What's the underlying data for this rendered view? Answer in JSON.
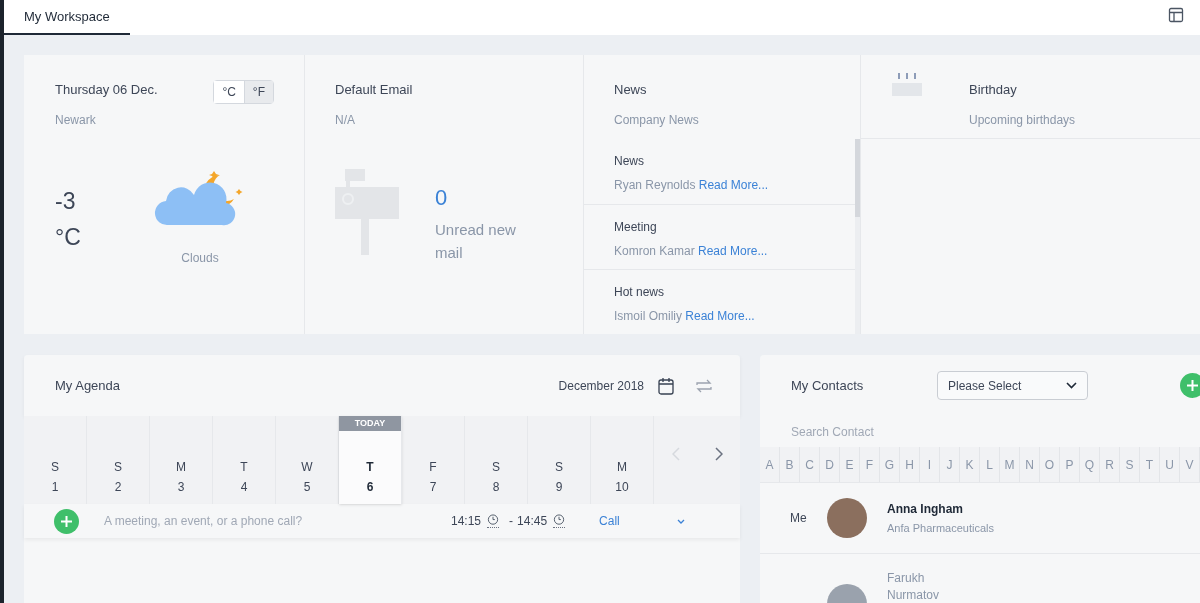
{
  "tabs": [
    {
      "label": "My Workspace",
      "selected": true
    }
  ],
  "weather": {
    "date": "Thursday 06 Dec.",
    "city": "Newark",
    "units": [
      {
        "label": "°C",
        "selected": false
      },
      {
        "label": "°F",
        "selected": true
      }
    ],
    "temperature": "-3",
    "unit": "°C",
    "condition": "Clouds"
  },
  "email": {
    "title": "Default Email",
    "account": "N/A",
    "count": "0",
    "caption": "Unread new mail"
  },
  "news": {
    "title": "News",
    "subtitle": "Company News",
    "items": [
      {
        "title": "News",
        "author": "Ryan Reynolds",
        "link": "Read More..."
      },
      {
        "title": "Meeting",
        "author": "Komron Kamar",
        "link": "Read More..."
      },
      {
        "title": "Hot news",
        "author": "Ismoil Omiliy",
        "link": "Read More..."
      }
    ]
  },
  "birthday": {
    "title": "Birthday",
    "subtitle": "Upcoming birthdays"
  },
  "agenda": {
    "title": "My Agenda",
    "month": "December 2018",
    "today_label": "TODAY",
    "days": [
      {
        "weekday": "S",
        "date": "1",
        "selected": false
      },
      {
        "weekday": "S",
        "date": "2",
        "selected": false
      },
      {
        "weekday": "M",
        "date": "3",
        "selected": false
      },
      {
        "weekday": "T",
        "date": "4",
        "selected": false
      },
      {
        "weekday": "W",
        "date": "5",
        "selected": false
      },
      {
        "weekday": "T",
        "date": "6",
        "selected": true
      },
      {
        "weekday": "F",
        "date": "7",
        "selected": false
      },
      {
        "weekday": "S",
        "date": "8",
        "selected": false
      },
      {
        "weekday": "S",
        "date": "9",
        "selected": false
      },
      {
        "weekday": "M",
        "date": "10",
        "selected": false
      }
    ],
    "new_event": {
      "placeholder": "A meeting, an event, or a phone call?",
      "start": "14:15",
      "separator": "-",
      "end": "14:45",
      "type": "Call"
    }
  },
  "contacts": {
    "title": "My Contacts",
    "filter": "Please Select",
    "search_placeholder": "Search Contact",
    "letters": [
      "A",
      "B",
      "C",
      "D",
      "E",
      "F",
      "G",
      "H",
      "I",
      "J",
      "K",
      "L",
      "M",
      "N",
      "O",
      "P",
      "Q",
      "R",
      "S",
      "T",
      "U",
      "V"
    ],
    "people": [
      {
        "kind": "me",
        "tag": "Me",
        "first_name": "Anna Ingham",
        "company": "Anfa Pharmaceuticals"
      },
      {
        "kind": "other",
        "first_name": "Farukh",
        "last_name": "Nurmatov"
      }
    ]
  }
}
